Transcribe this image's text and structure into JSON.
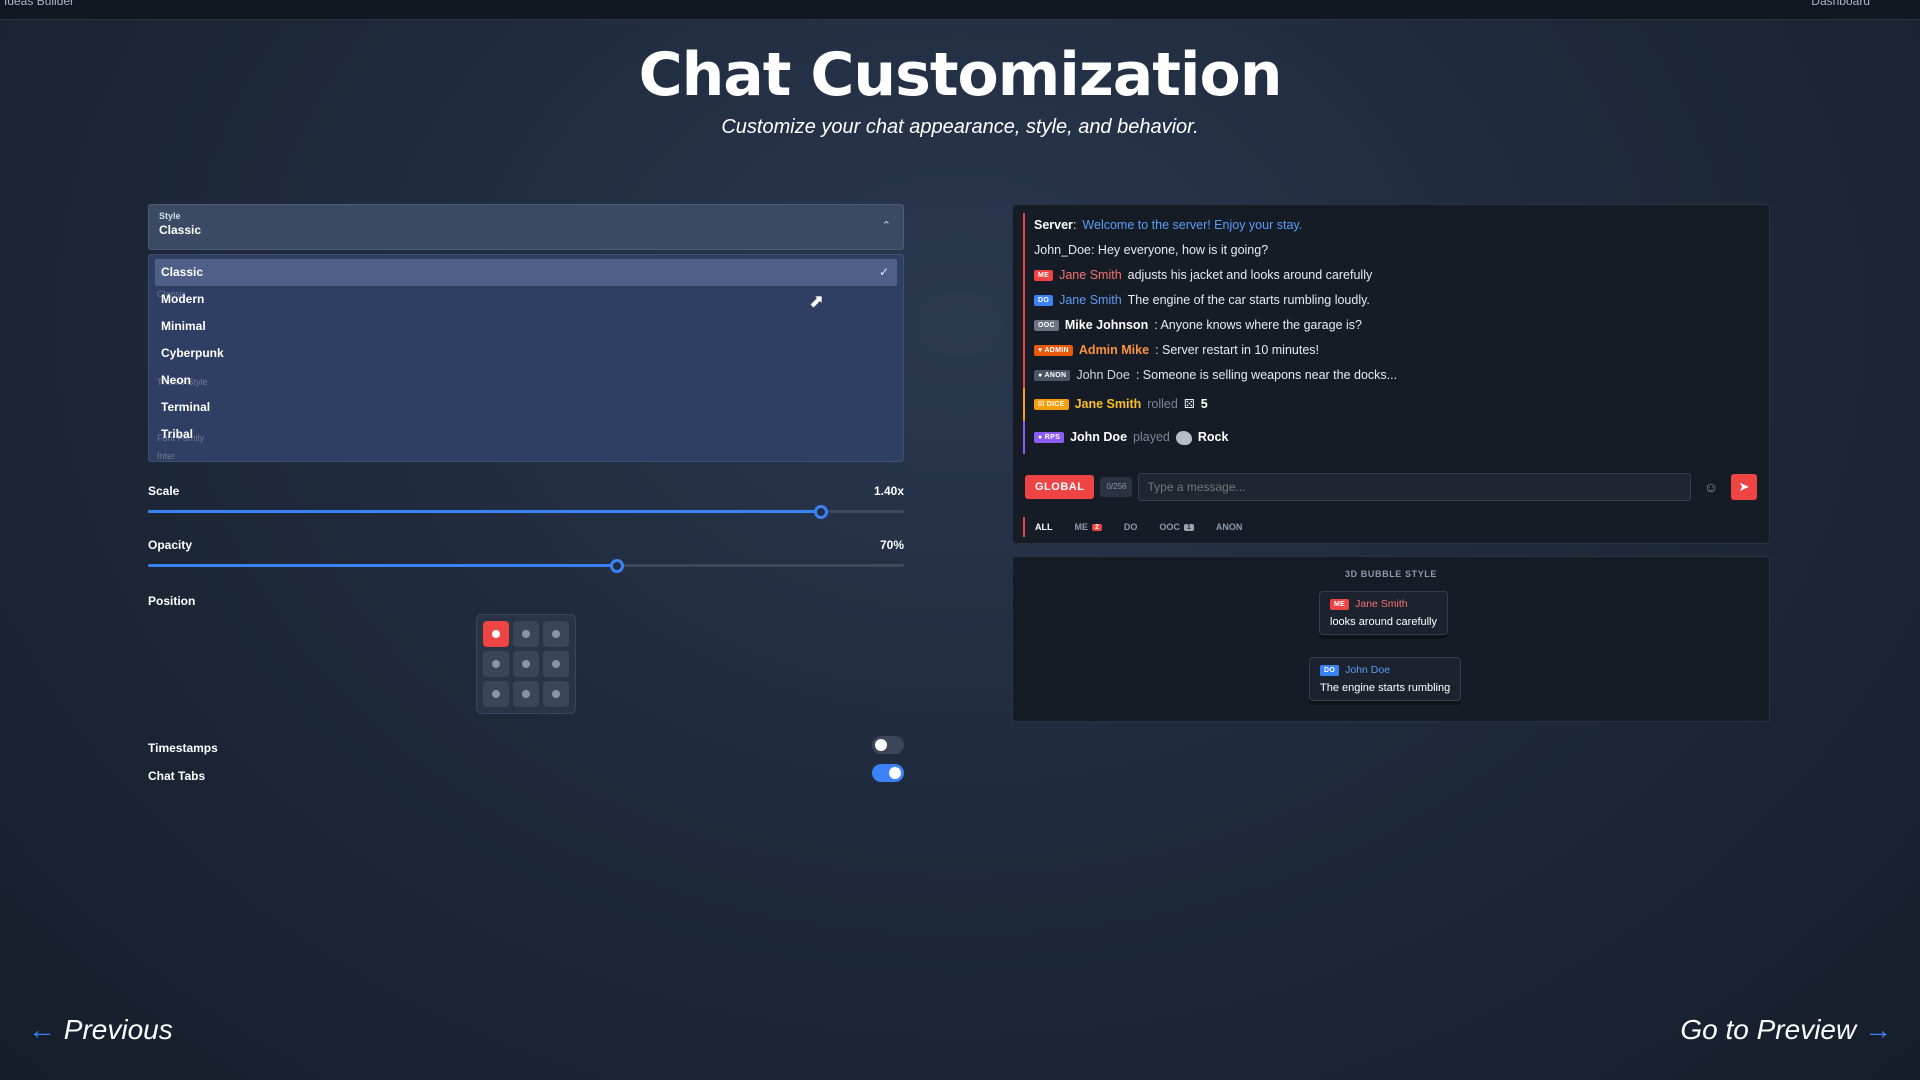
{
  "window": {
    "title_left": "Ideas Builder",
    "title_right": "Dashboard"
  },
  "header": {
    "title": "Chat Customization",
    "subtitle": "Customize your chat appearance, style, and behavior."
  },
  "settings": {
    "style_select": {
      "label": "Style",
      "value": "Classic"
    },
    "style_options": [
      "Classic",
      "Modern",
      "Minimal",
      "Cyberpunk",
      "Neon",
      "Terminal",
      "Tribal"
    ],
    "selected_option": "Classic",
    "hidden_labels": [
      "Classic",
      "Theme Style",
      "Font Family",
      "Inter"
    ],
    "scale": {
      "label": "Scale",
      "value_text": "1.40x",
      "fraction": 0.89
    },
    "opacity": {
      "label": "Opacity",
      "value_text": "70%",
      "fraction": 0.62
    },
    "position": {
      "label": "Position",
      "selected_index": 0
    },
    "timestamps": {
      "label": "Timestamps",
      "on": false
    },
    "chat_tabs": {
      "label": "Chat Tabs",
      "on": true
    }
  },
  "chat": {
    "messages": {
      "m1": {
        "name": "Server",
        "text": "Welcome to the server! Enjoy your stay."
      },
      "m2": {
        "text": "John_Doe: Hey everyone, how is it going?"
      },
      "m3": {
        "badge": "ME",
        "name": "Jane Smith",
        "text": "adjusts his jacket and looks around carefully"
      },
      "m4": {
        "badge": "DO",
        "name": "Jane Smith",
        "text": "The engine of the car starts rumbling loudly."
      },
      "m5": {
        "badge": "OOC",
        "name": "Mike Johnson",
        "text": ": Anyone knows where the garage is?"
      },
      "m6": {
        "badge": "ADMIN",
        "name": "Admin Mike",
        "text": ": Server restart in 10 minutes!"
      },
      "m7": {
        "badge": "ANON",
        "name": "John Doe",
        "text": ": Someone is selling weapons near the docks..."
      },
      "m8": {
        "badge": "DICE",
        "name": "Jane Smith",
        "verb": "rolled",
        "value": "5"
      },
      "m9": {
        "badge": "RPS",
        "name": "John Doe",
        "verb": "played",
        "value": "Rock"
      }
    },
    "input": {
      "channel": "GLOBAL",
      "counter": "0/256",
      "placeholder": "Type a message..."
    },
    "tabs": {
      "all": "ALL",
      "me": "ME",
      "me_count": "2",
      "do": "DO",
      "ooc": "OOC",
      "ooc_count": "1",
      "anon": "ANON"
    }
  },
  "bubble_preview": {
    "title": "3D BUBBLE STYLE",
    "b1": {
      "badge": "ME",
      "name": "Jane Smith",
      "text": "looks around carefully"
    },
    "b2": {
      "badge": "DO",
      "name": "John Doe",
      "text": "The engine starts rumbling"
    }
  },
  "nav": {
    "previous": "Previous",
    "next": "Go to Preview"
  },
  "colors": {
    "accent_red": "#ef4444",
    "accent_blue": "#3b82f6",
    "background": "#1f2a3c"
  }
}
